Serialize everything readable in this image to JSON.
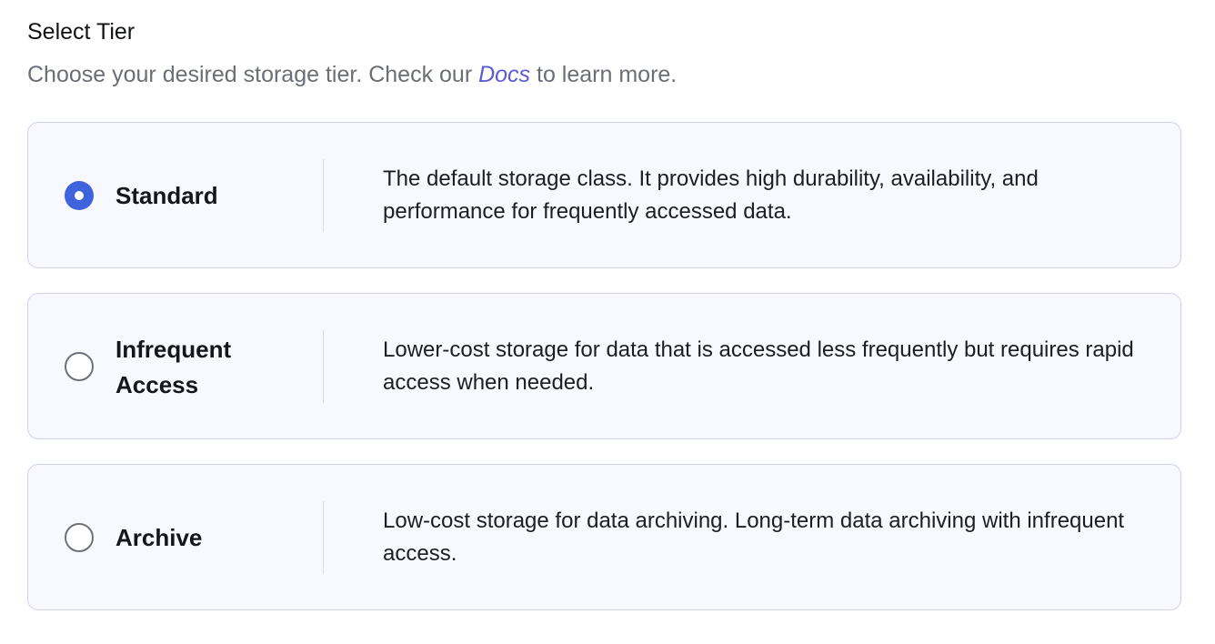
{
  "header": {
    "title": "Select Tier",
    "subtitle_before": "Choose your desired storage tier. Check our ",
    "docs_link": "Docs",
    "subtitle_after": " to learn more."
  },
  "tiers": [
    {
      "name": "Standard",
      "selected": true,
      "description": "The default storage class. It provides high durability, availability, and performance for frequently accessed data."
    },
    {
      "name": "Infrequent Access",
      "selected": false,
      "description": "Lower-cost storage for data that is accessed less frequently but requires rapid access when needed."
    },
    {
      "name": "Archive",
      "selected": false,
      "description": "Low-cost storage for data archiving. Long-term data archiving with infrequent access."
    }
  ],
  "colors": {
    "accent": "#3e63dd",
    "link": "#5b5bd6",
    "card_border": "#cfd3f3",
    "card_background": "#f8f9fe",
    "muted_text": "#6b6e76"
  }
}
